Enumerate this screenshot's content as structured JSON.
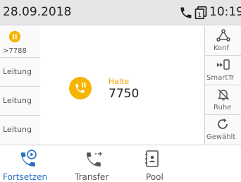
{
  "statusbar": {
    "date": "28.09.2018",
    "time": "10:19",
    "line_number": "1"
  },
  "left_keys": [
    {
      "label": ">7788",
      "icon": "hold-icon"
    },
    {
      "label": "Leitung"
    },
    {
      "label": "Leitung"
    },
    {
      "label": "Leitung"
    }
  ],
  "call": {
    "status": "Halte",
    "number": "7750",
    "icon": "phone-hold-icon"
  },
  "right_keys": [
    {
      "label": "Konf",
      "icon": "conference-icon"
    },
    {
      "label": "SmartTr",
      "icon": "smart-transfer-icon"
    },
    {
      "label": "Ruhe",
      "icon": "do-not-disturb-icon"
    },
    {
      "label": "Gewählt",
      "icon": "redial-icon"
    }
  ],
  "bottom_keys": [
    {
      "label": "Fortsetzen",
      "icon": "resume-call-icon",
      "active": true
    },
    {
      "label": "Transfer",
      "icon": "transfer-icon"
    },
    {
      "label": "Pool",
      "icon": "contact-pool-icon"
    }
  ],
  "colors": {
    "accent_blue": "#2a6fbf",
    "hold_yellow": "#f5b400"
  }
}
